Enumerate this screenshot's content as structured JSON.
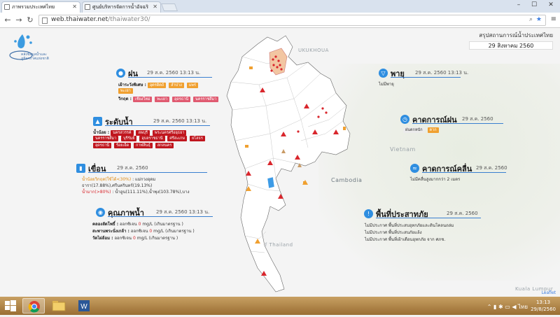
{
  "browser": {
    "tabs": [
      {
        "label": "ภาพรวมประเทศไทย",
        "active": true
      },
      {
        "label": "ศูนย์บริหารจัดการน้ำอัจฉริ",
        "active": false
      }
    ],
    "url_host": "web.thaiwater.net",
    "url_path": "/thaiwater30/"
  },
  "logo": {
    "text_line1": "คลังข้อมูลน้ำและ",
    "text_line2": "ภูมิอากาศแห่งชาติ"
  },
  "summary": {
    "title": "สรุปสถานการณ์น้ำประเทศไทย",
    "date": "29 สิงหาคม 2560"
  },
  "map_labels": [
    "UKUKHOUA",
    "Vietnam",
    "Cambodia",
    "Gulf of Thailand",
    "Kuala Lumpur",
    "Leaflet"
  ],
  "rain": {
    "title": "ฝน",
    "date": "29 ส.ค. 2560 13:13 น.",
    "watch_label": "เฝ้าระวังพิเศษ :",
    "watch_tags": [
      "อุตรดิตถ์",
      "ลำปาง",
      "แพร่",
      "พะเยา"
    ],
    "critical_label": "วิกฤต :",
    "critical_tags": [
      "เชียงใหม่",
      "พะเยา",
      "อุดรธานี",
      "นครราชสีมา"
    ]
  },
  "water_level": {
    "title": "ระดับน้ำ",
    "date": "29 ส.ค. 2560 13:13 น.",
    "label": "น้ำน้อย :",
    "tags_row1": [
      "นครสวรรค์",
      "ลพบุรี",
      "พระนครศรีอยุธยา"
    ],
    "tags_row2": [
      "นครราชสีมา",
      "บุรีรัมย์",
      "อุบลราชธานี",
      "ศรีสะเกษ",
      "ยโสธร"
    ],
    "tags_row3": [
      "อุดรธานี",
      "ร้อยเอ็ด",
      "กาฬสินธุ์",
      "สกลนคร"
    ]
  },
  "dam": {
    "title": "เขื่อน",
    "date": "29 ส.ค. 2560",
    "row1_prefix": "น้ำน้อยวิกฤต(ใช้ได้<30%)",
    "row1_value": "แม่กวงอุดม",
    "row2": "ธารา(17.88%),ศรีนครินทร์(19.13%)",
    "row3_prefix": "น้ำมาก(>80%)",
    "row3_value": "น้ำอูน(111.11%),น้ำพุง(103.78%),บาง"
  },
  "quality": {
    "title": "คุณภาพน้ำ",
    "date": "29 ส.ค. 2560 13:13 น.",
    "rows": [
      {
        "station": "คลองลัดโพธิ์ :",
        "text": "ออกซิเจน",
        "value": "0",
        "unit": "mg/L",
        "note": "(เกินมาตรฐาน )"
      },
      {
        "station": "สะพานพระนั่งเกล้า :",
        "text": "ออกซิเจน",
        "value": "0",
        "unit": "mg/L",
        "note": "(เกินมาตรฐาน )"
      },
      {
        "station": "วัดไผ่ล้อม :",
        "text": "ออกซิเจน",
        "value": "0",
        "unit": "mg/L",
        "note": "(เกินมาตรฐาน )"
      }
    ]
  },
  "storm": {
    "title": "พายุ",
    "date": "29 ส.ค. 2560 13:13 น.",
    "text": "ไม่มีพายุ"
  },
  "forecast_rain": {
    "title": "คาดการณ์ฝน",
    "date": "29 ส.ค. 2560",
    "label": "ฝนตกหนัก",
    "tag": "ตาก"
  },
  "forecast_wave": {
    "title": "คาดการณ์คลื่น",
    "date": "29 ส.ค. 2560",
    "text": "ไม่มีคลื่นสูงมากกว่า 2 เมตร"
  },
  "disaster": {
    "title": "พื้นที่ประสาทภัย",
    "date": "29 ส.ค. 2560",
    "rows": [
      "ไม่มีประกาศ  พื้นที่ประสบอุทกภัยและดินโคลนถล่ม",
      "ไม่มีประกาศ  พื้นที่ประสบภัยแล้ง",
      "ไม่มีประกาศ  พื้นที่เฝ้าเตือนอุทกภัย จาก ศภช."
    ]
  },
  "taskbar": {
    "tray_lang": "ไทย",
    "time": "13:13",
    "date": "29/8/2560"
  },
  "colors": {
    "accent": "#2f8ee0",
    "warning": "#f0a030",
    "critical": "#d94040",
    "taskbar": "#b08548"
  }
}
